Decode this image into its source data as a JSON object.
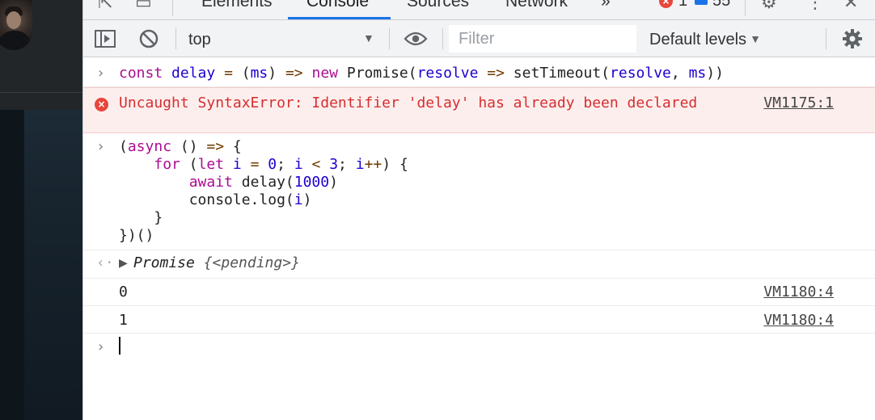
{
  "tabs": {
    "elements": "Elements",
    "console": "Console",
    "sources": "Sources",
    "network": "Network",
    "more": "»",
    "error_count": "1",
    "message_count": "55"
  },
  "toolbar": {
    "context": "top",
    "filter_placeholder": "Filter",
    "levels": "Default levels"
  },
  "console": {
    "input1": {
      "parts": [
        "const",
        "delay",
        "=",
        "(ms)",
        "=>",
        "new",
        "Promise(",
        "resolve",
        "=>",
        "setTimeout(",
        "resolve",
        ",",
        "ms",
        "))"
      ]
    },
    "error": {
      "message": "Uncaught SyntaxError: Identifier 'delay' has already been declared",
      "source": "VM1175:1"
    },
    "result": {
      "label": "Promise",
      "value": "{<pending>}"
    },
    "logs": [
      {
        "value": "0",
        "source": "VM1180:4"
      },
      {
        "value": "1",
        "source": "VM1180:4"
      }
    ]
  },
  "colors": {
    "accent": "#1a73e8",
    "error": "#e8453c",
    "error_bg": "#fdeeee"
  }
}
